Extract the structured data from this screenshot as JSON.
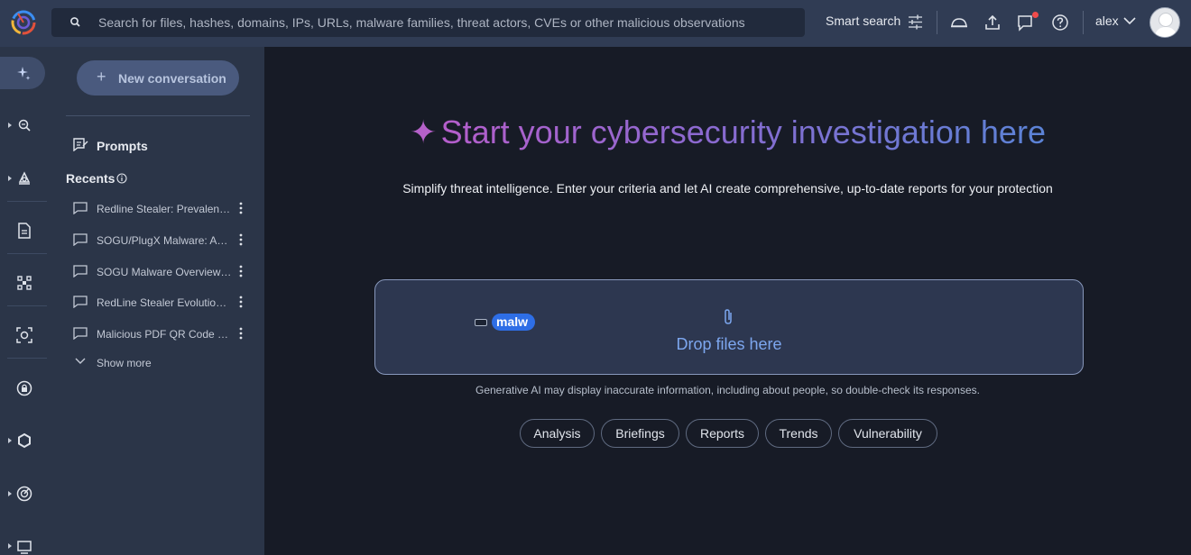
{
  "search": {
    "placeholder": "Search for files, hashes, domains, IPs, URLs, malware families, threat actors, CVEs or other malicious observations"
  },
  "topbar": {
    "smart_search_label": "Smart search",
    "user_name": "alex",
    "notification_dot_color": "#f04b4b"
  },
  "sidebar": {
    "new_conversation_label": "New conversation",
    "prompts_label": "Prompts",
    "recents_label": "Recents",
    "recents": [
      {
        "title": "Redline Stealer: Prevalence and Analysis"
      },
      {
        "title": "SOGU/PlugX Malware: Activity Overview"
      },
      {
        "title": "SOGU Malware Overview and Analysis"
      },
      {
        "title": "RedLine Stealer Evolution and Trends"
      },
      {
        "title": "Malicious PDF QR Code Phishing"
      }
    ],
    "show_more_label": "Show more"
  },
  "rail": {
    "icons": [
      "sparkle-icon",
      "search-scan-icon",
      "hunting-icon",
      "document-icon",
      "graph-icon",
      "detection-icon",
      "lock-icon",
      "hexagon-icon",
      "radar-icon",
      "monitor-icon"
    ]
  },
  "main": {
    "title_glyph": "✦",
    "title": "Start your cybersecurity investigation here",
    "subtitle": "Simplify threat intelligence. Enter your criteria and let AI create comprehensive, up-to-date reports for your protection",
    "input_chip": "malw",
    "drop_label": "Drop files here",
    "disclaimer": "Generative AI may display inaccurate information, including about people, so double-check its responses.",
    "suggestions": [
      "Analysis",
      "Briefings",
      "Reports",
      "Trends",
      "Vulnerability"
    ]
  },
  "colors": {
    "accent_blue": "#2e6ee6",
    "title_gradient_start": "#b55ecb",
    "title_gradient_end": "#5b83d6",
    "background": "#171b26"
  }
}
